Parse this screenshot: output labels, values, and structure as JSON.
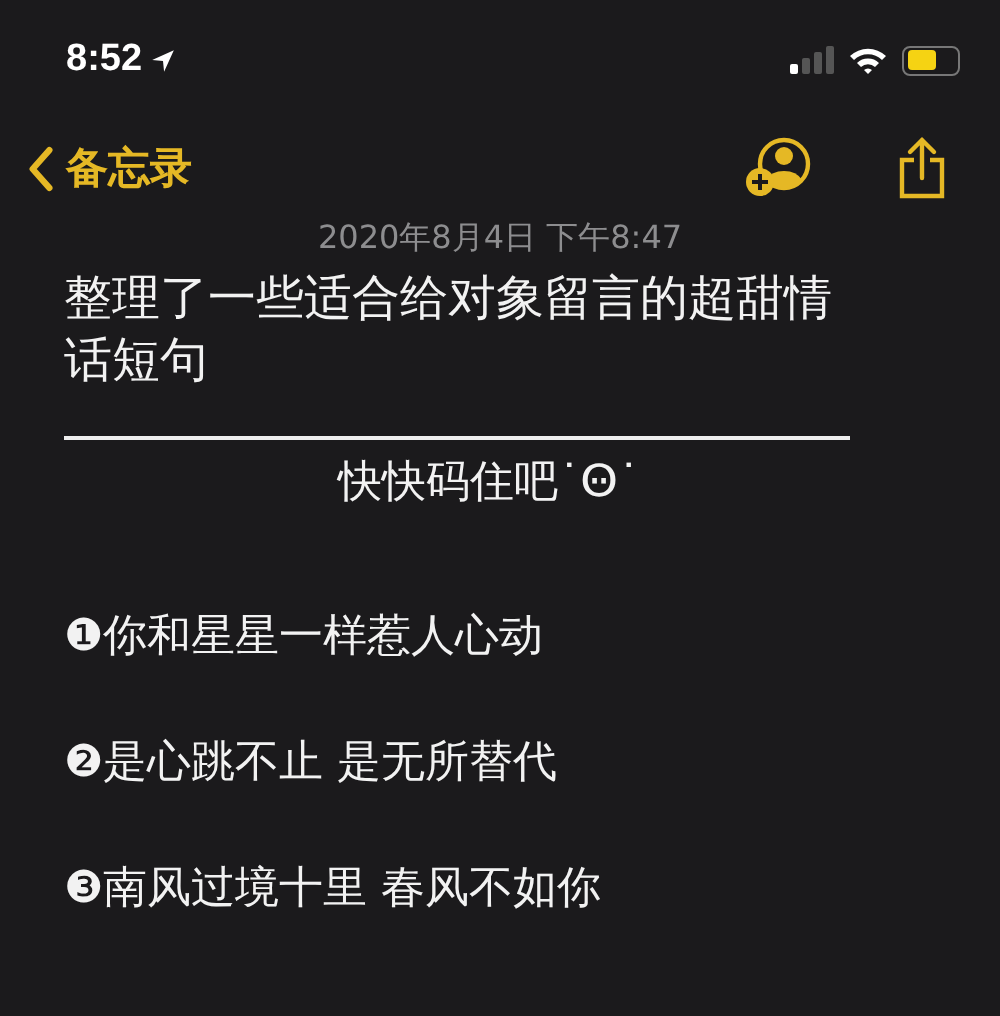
{
  "status_bar": {
    "time": "8:52"
  },
  "nav": {
    "back_label": "备忘录"
  },
  "note": {
    "date": "2020年8月4日 下午8:47",
    "title": "整理了一些适合给对象留言的超甜情话短句",
    "subtitle": "快快码住吧˙Ꙫ˙",
    "items": [
      "❶你和星星一样惹人心动",
      "❷是心跳不止 是无所替代",
      "❸南风过境十里 春风不如你"
    ]
  }
}
